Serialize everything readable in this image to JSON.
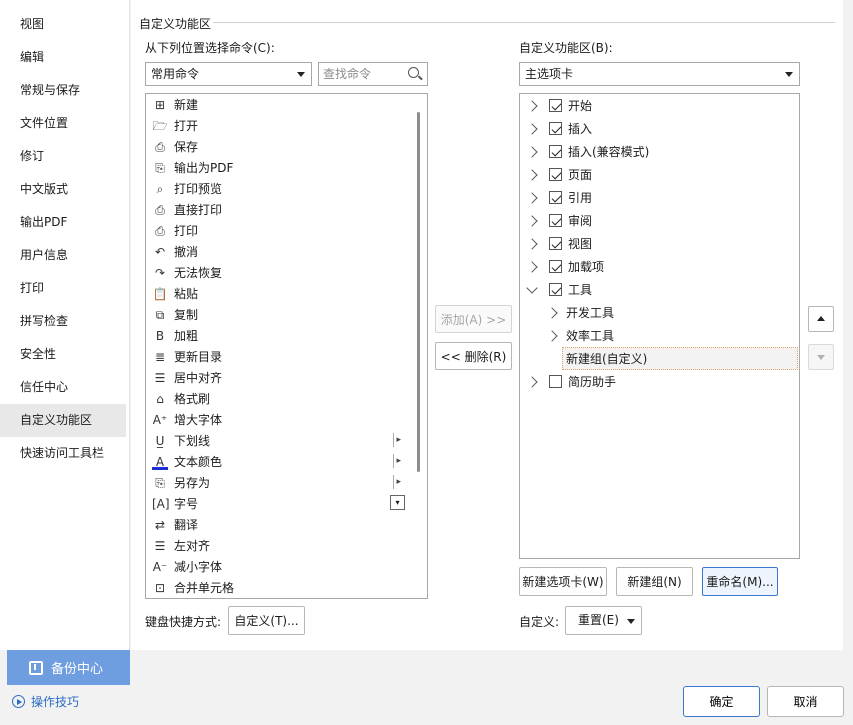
{
  "nav": {
    "items": [
      "视图",
      "编辑",
      "常规与保存",
      "文件位置",
      "修订",
      "中文版式",
      "输出PDF",
      "用户信息",
      "打印",
      "拼写检查",
      "安全性",
      "信任中心",
      "自定义功能区",
      "快速访问工具栏"
    ],
    "active_index": 12,
    "backup_label": "备份中心",
    "tips_label": "操作技巧"
  },
  "section_title": "自定义功能区",
  "left": {
    "choose_label": "从下列位置选择命令(C):",
    "choose_value": "常用命令",
    "search_placeholder": "查找命令",
    "commands": [
      {
        "label": "新建",
        "icon": "⊞"
      },
      {
        "label": "打开",
        "icon": "🗁"
      },
      {
        "label": "保存",
        "icon": "⎙"
      },
      {
        "label": "输出为PDF",
        "icon": "⎘"
      },
      {
        "label": "打印预览",
        "icon": "⌕"
      },
      {
        "label": "直接打印",
        "icon": "⎙"
      },
      {
        "label": "打印",
        "icon": "⎙"
      },
      {
        "label": "撤消",
        "icon": "↶"
      },
      {
        "label": "无法恢复",
        "icon": "↷"
      },
      {
        "label": "粘贴",
        "icon": "📋"
      },
      {
        "label": "复制",
        "icon": "⧉"
      },
      {
        "label": "加粗",
        "icon": "B"
      },
      {
        "label": "更新目录",
        "icon": "≣"
      },
      {
        "label": "居中对齐",
        "icon": "☰"
      },
      {
        "label": "格式刷",
        "icon": "⌂"
      },
      {
        "label": "增大字体",
        "icon": "A⁺"
      },
      {
        "label": "下划线",
        "icon": "U̲",
        "arrow": true
      },
      {
        "label": "文本颜色",
        "icon": "A",
        "arrow": true
      },
      {
        "label": "另存为",
        "icon": "⎘",
        "arrow": true
      },
      {
        "label": "字号",
        "icon": "[A]",
        "box": true
      },
      {
        "label": "翻译",
        "icon": "⇄"
      },
      {
        "label": "左对齐",
        "icon": "☰"
      },
      {
        "label": "减小字体",
        "icon": "A⁻"
      },
      {
        "label": "合并单元格",
        "icon": "⊡"
      }
    ],
    "shortcut_label": "键盘快捷方式:",
    "shortcut_button": "自定义(T)..."
  },
  "middle": {
    "add_button": "添加(A) >>",
    "remove_button": "<< 删除(R)"
  },
  "right": {
    "ribbon_label": "自定义功能区(B):",
    "ribbon_value": "主选项卡",
    "tree": [
      {
        "label": "开始",
        "checked": true,
        "level": 0,
        "expanded": false
      },
      {
        "label": "插入",
        "checked": true,
        "level": 0,
        "expanded": false
      },
      {
        "label": "插入(兼容模式)",
        "checked": true,
        "level": 0,
        "expanded": false
      },
      {
        "label": "页面",
        "checked": true,
        "level": 0,
        "expanded": false
      },
      {
        "label": "引用",
        "checked": true,
        "level": 0,
        "expanded": false
      },
      {
        "label": "审阅",
        "checked": true,
        "level": 0,
        "expanded": false
      },
      {
        "label": "视图",
        "checked": true,
        "level": 0,
        "expanded": false
      },
      {
        "label": "加载项",
        "checked": true,
        "level": 0,
        "expanded": false
      },
      {
        "label": "工具",
        "checked": true,
        "level": 0,
        "expanded": true
      },
      {
        "label": "开发工具",
        "level": 1,
        "expanded": false
      },
      {
        "label": "效率工具",
        "level": 1,
        "expanded": false
      },
      {
        "label": "新建组(自定义)",
        "level": 1,
        "selected": true
      },
      {
        "label": "简历助手",
        "checked": false,
        "level": 0,
        "expanded": false
      }
    ],
    "new_tab_button": "新建选项卡(W)",
    "new_group_button": "新建组(N)",
    "rename_button": "重命名(M)...",
    "customize_label": "自定义:",
    "reset_button": "重置(E)"
  },
  "footer": {
    "ok_button": "确定",
    "cancel_button": "取消"
  }
}
